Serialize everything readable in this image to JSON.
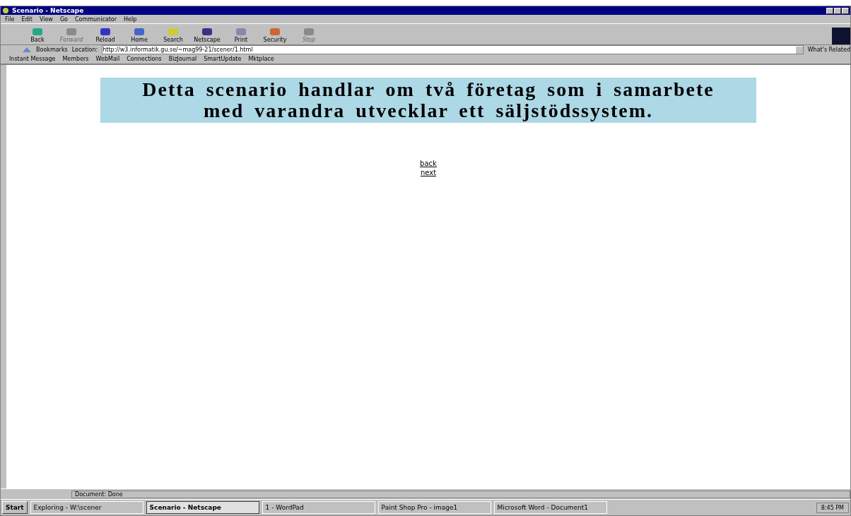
{
  "window": {
    "title": "Scenario - Netscape"
  },
  "menu": [
    "File",
    "Edit",
    "View",
    "Go",
    "Communicator",
    "Help"
  ],
  "toolbar": [
    {
      "label": "Back",
      "disabled": false
    },
    {
      "label": "Forward",
      "disabled": true
    },
    {
      "label": "Reload",
      "disabled": false
    },
    {
      "label": "Home",
      "disabled": false
    },
    {
      "label": "Search",
      "disabled": false
    },
    {
      "label": "Netscape",
      "disabled": false
    },
    {
      "label": "Print",
      "disabled": false
    },
    {
      "label": "Security",
      "disabled": false
    },
    {
      "label": "Stop",
      "disabled": true
    }
  ],
  "location": {
    "bookmarks": "Bookmarks",
    "label": "Location:",
    "url": "http://w3.informatik.gu.se/~mag99-21/scener/1.html",
    "related": "What's Related"
  },
  "personal_toolbar": [
    "Instant Message",
    "Members",
    "WebMail",
    "Connections",
    "BizJournal",
    "SmartUpdate",
    "Mktplace"
  ],
  "page": {
    "heading": "Detta scenario handlar om två företag som i samarbete med varandra utvecklar ett säljstödssystem.",
    "links": [
      "back",
      "next"
    ]
  },
  "status_bar": {
    "text": "Document: Done"
  },
  "taskbar": {
    "start": "Start",
    "tasks": [
      {
        "label": "Exploring - W:\\scener",
        "selected": false
      },
      {
        "label": "Scenario - Netscape",
        "selected": true
      },
      {
        "label": "1 - WordPad",
        "selected": false
      },
      {
        "label": "Paint Shop Pro - image1",
        "selected": false
      },
      {
        "label": "Microsoft Word - Document1",
        "selected": false
      }
    ],
    "clock": "8:45 PM"
  }
}
